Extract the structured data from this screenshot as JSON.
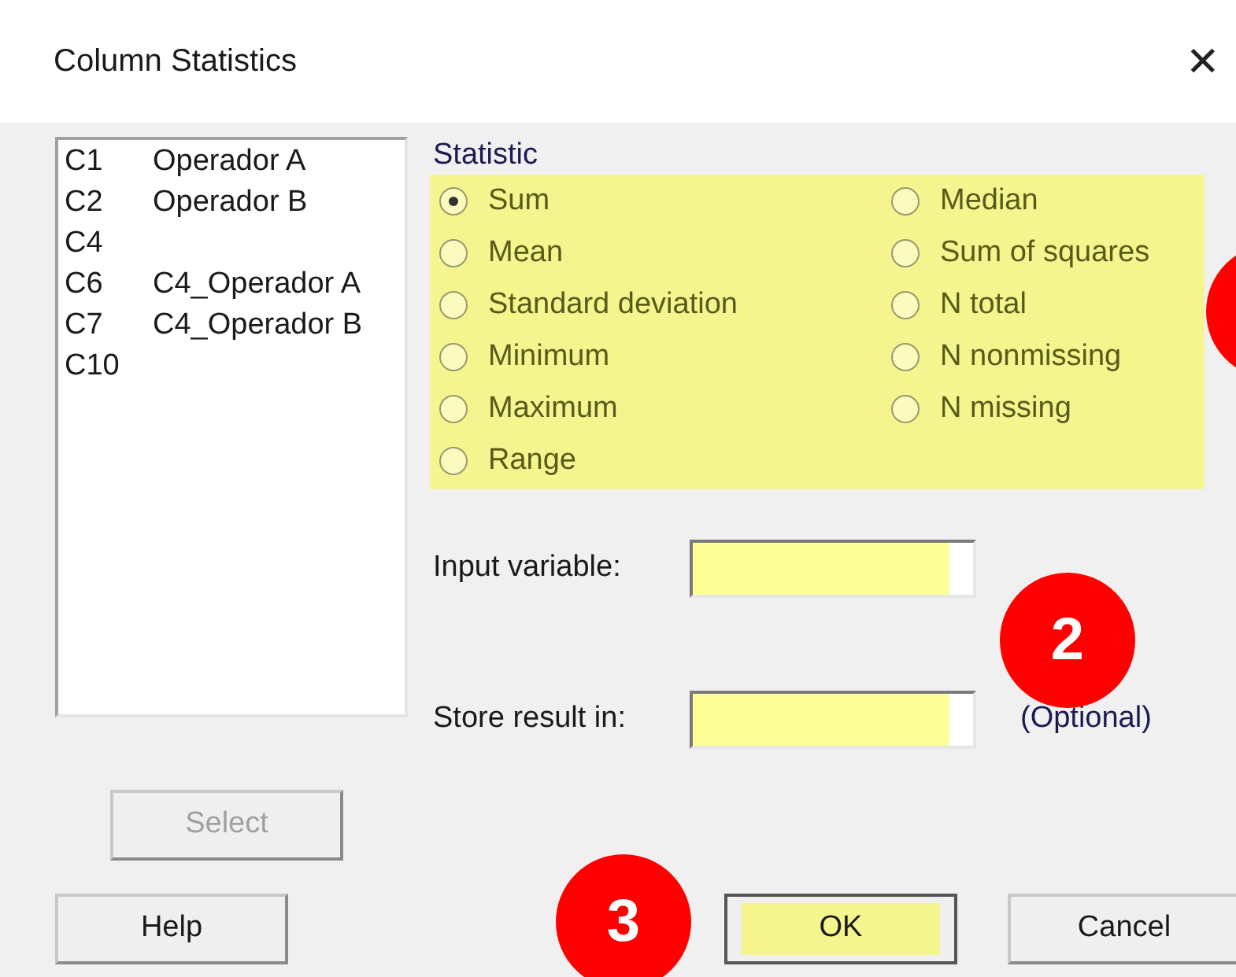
{
  "window": {
    "title": "Column Statistics",
    "close": "✕"
  },
  "columns_list": [
    {
      "id": "C1",
      "name": "Operador A"
    },
    {
      "id": "C2",
      "name": "Operador B"
    },
    {
      "id": "C4"
    },
    {
      "id": "C6",
      "name": "C4_Operador A"
    },
    {
      "id": "C7",
      "name": "C4_Operador B"
    },
    {
      "id": "C10"
    }
  ],
  "statistic": {
    "label": "Statistic",
    "highlighted": true,
    "options": [
      {
        "label": "Sum",
        "selected": true
      },
      {
        "label": "Median",
        "selected": false
      },
      {
        "label": "Mean",
        "selected": false
      },
      {
        "label": "Sum of squares",
        "selected": false
      },
      {
        "label": "Standard deviation",
        "selected": false
      },
      {
        "label": "N total",
        "selected": false
      },
      {
        "label": "Minimum",
        "selected": false
      },
      {
        "label": "N nonmissing",
        "selected": false
      },
      {
        "label": "Maximum",
        "selected": false
      },
      {
        "label": "N missing",
        "selected": false
      },
      {
        "label": "Range",
        "selected": false
      }
    ]
  },
  "input_variable": {
    "label": "Input variable:",
    "highlighted": true
  },
  "store_result": {
    "label": "Store result in:",
    "highlighted": true,
    "note": "(Optional)"
  },
  "buttons": {
    "select": {
      "label": "Select",
      "disabled": true
    },
    "help": {
      "label": "Help"
    },
    "ok": {
      "label": "OK",
      "highlighted": true
    },
    "cancel": {
      "label": "Cancel"
    }
  },
  "callouts": [
    {
      "kind": "partial"
    },
    {
      "kind": "number",
      "label": "2"
    },
    {
      "kind": "number",
      "label": "3"
    }
  ]
}
